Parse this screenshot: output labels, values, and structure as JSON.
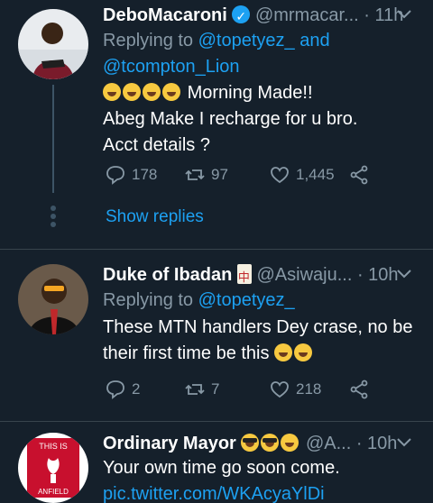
{
  "colors": {
    "background": "#15202b",
    "accent": "#1da1f2",
    "muted": "#8899a6",
    "text": "#ffffff"
  },
  "tweets": [
    {
      "display_name": "DeboMacaroni",
      "handle": "@mrmacar...",
      "time": "· 11h",
      "replying_prefix": "Replying to",
      "replying_to_1": "@topetyez_",
      "replying_and": "and",
      "replying_to_2": "@tcompton_Lion",
      "text_line1": "Morning Made!!",
      "text_line2": "Abeg Make I recharge for u bro.",
      "text_line3": "Acct details ?",
      "replies": "178",
      "retweets": "97",
      "likes": "1,445",
      "show_replies": "Show replies"
    },
    {
      "display_name": "Duke of Ibadan",
      "handle": "@Asiwaju...",
      "time": "· 10h",
      "replying_prefix": "Replying to",
      "replying_to_1": "@topetyez_",
      "text_line1": "These MTN handlers Dey crase, no be",
      "text_line2": "their first time be this",
      "replies": "2",
      "retweets": "7",
      "likes": "218"
    },
    {
      "display_name": "Ordinary Mayor",
      "handle": "@A...",
      "time": "· 10h",
      "text_line1": "Your own time go soon come.",
      "link": "pic.twitter.com/WKAcyaYlDi",
      "avatar_text_top": "THIS IS",
      "avatar_text_bottom": "ANFIELD"
    }
  ]
}
